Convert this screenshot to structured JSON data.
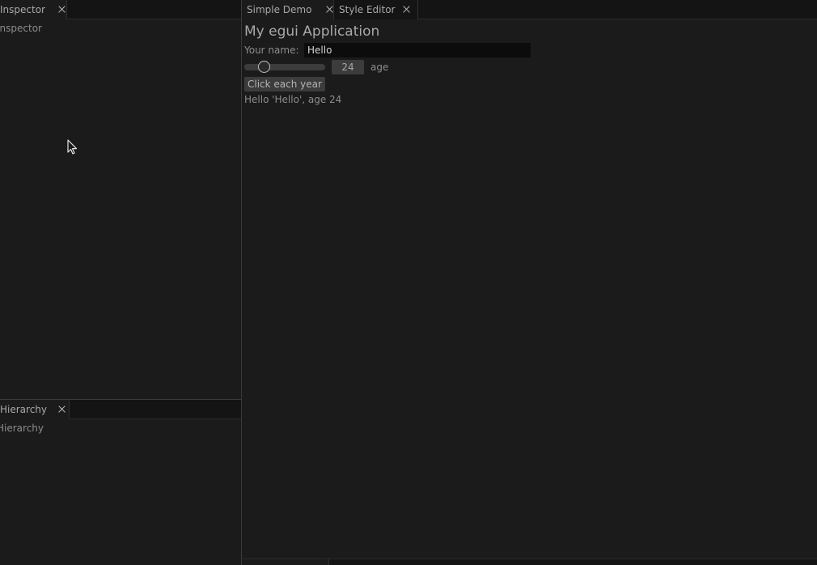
{
  "left_top": {
    "tab_label": "Inspector",
    "body_label": "Inspector"
  },
  "left_bottom": {
    "tab_label": "Hierarchy",
    "body_label": "Hierarchy"
  },
  "right": {
    "tabs": [
      {
        "label": "Simple Demo",
        "active": true
      },
      {
        "label": "Style Editor",
        "active": false
      }
    ],
    "heading": "My egui Application",
    "name_label": "Your name:",
    "name_value": "Hello",
    "age_value": "24",
    "age_fraction": 0.24,
    "age_label": "age",
    "button_label": "Click each year",
    "result_text": "Hello 'Hello', age 24"
  },
  "icons": {
    "tab_close": "close-icon",
    "cursor": "mouse-pointer-icon"
  },
  "colors": {
    "background": "#1b1b1b",
    "tabbar": "#141414",
    "input_bg": "#0c0c0c",
    "widget_bg": "#3c3c3c"
  }
}
